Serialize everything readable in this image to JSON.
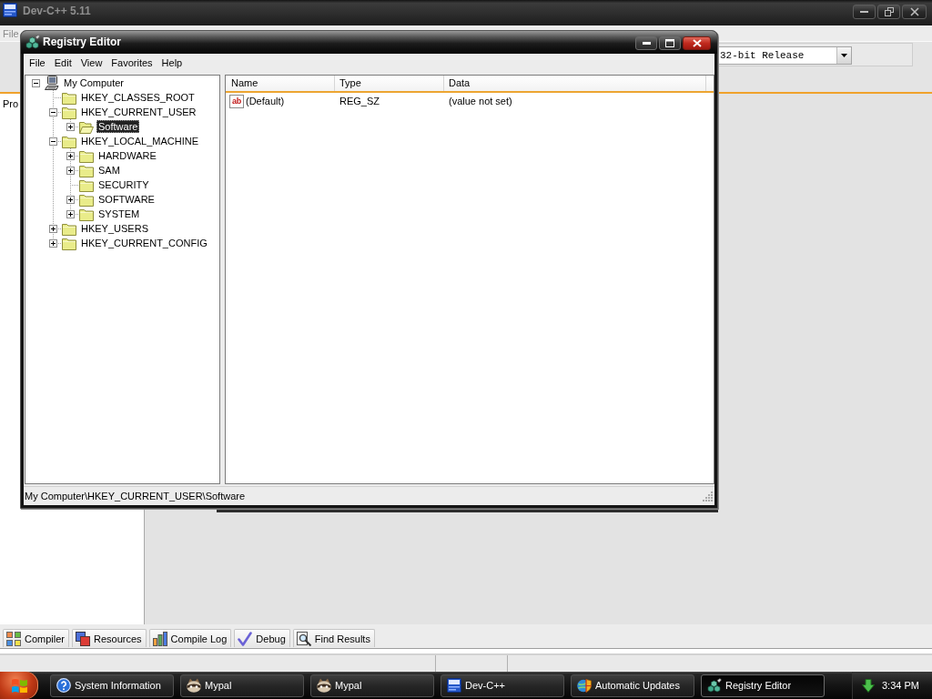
{
  "background_window": {
    "title": "Dev-C++ 5.11",
    "menu": [
      "File"
    ],
    "toolbar": {
      "dropdown": {
        "value": "32-bit Release"
      }
    },
    "side_panel": {
      "tab": "Pro"
    },
    "bottom_tabs": [
      {
        "label": "Compiler",
        "selected": false
      },
      {
        "label": "Resources",
        "selected": false
      },
      {
        "label": "Compile Log",
        "selected": false
      },
      {
        "label": "Debug",
        "selected": false
      },
      {
        "label": "Find Results",
        "selected": false
      }
    ]
  },
  "registry_editor": {
    "title": "Registry Editor",
    "menu": [
      "File",
      "Edit",
      "View",
      "Favorites",
      "Help"
    ],
    "tree": [
      {
        "label": "My Computer",
        "kind": "computer",
        "expanded": true,
        "selected": false,
        "children": [
          {
            "label": "HKEY_CLASSES_ROOT",
            "kind": "folder",
            "selected": false
          },
          {
            "label": "HKEY_CURRENT_USER",
            "kind": "folder",
            "expanded": true,
            "selected": false,
            "children": [
              {
                "label": "Software",
                "kind": "folder",
                "expanded": false,
                "selected": true
              }
            ]
          },
          {
            "label": "HKEY_LOCAL_MACHINE",
            "kind": "folder",
            "expanded": true,
            "selected": false,
            "children": [
              {
                "label": "HARDWARE",
                "kind": "folder",
                "expanded": false,
                "selected": false
              },
              {
                "label": "SAM",
                "kind": "folder",
                "expanded": false,
                "selected": false
              },
              {
                "label": "SECURITY",
                "kind": "folder",
                "selected": false
              },
              {
                "label": "SOFTWARE",
                "kind": "folder",
                "expanded": false,
                "selected": false
              },
              {
                "label": "SYSTEM",
                "kind": "folder",
                "expanded": false,
                "selected": false
              }
            ]
          },
          {
            "label": "HKEY_USERS",
            "kind": "folder",
            "expanded": false,
            "selected": false
          },
          {
            "label": "HKEY_CURRENT_CONFIG",
            "kind": "folder",
            "expanded": false,
            "selected": false
          }
        ]
      }
    ],
    "list": {
      "columns": [
        "Name",
        "Type",
        "Data"
      ],
      "rows": [
        {
          "icon_text": "ab",
          "name": "(Default)",
          "type": "REG_SZ",
          "data": "(value not set)",
          "selected": false
        }
      ]
    },
    "status_bar": "My Computer\\HKEY_CURRENT_USER\\Software"
  },
  "taskbar": {
    "buttons": [
      {
        "label": "System Information",
        "selected": false
      },
      {
        "label": "Mypal",
        "selected": false
      },
      {
        "label": "Mypal",
        "selected": false
      },
      {
        "label": "Dev-C++",
        "selected": false
      },
      {
        "label": "Automatic Updates",
        "selected": false
      },
      {
        "label": "Registry Editor",
        "selected": true
      }
    ],
    "clock": "3:34 PM"
  }
}
